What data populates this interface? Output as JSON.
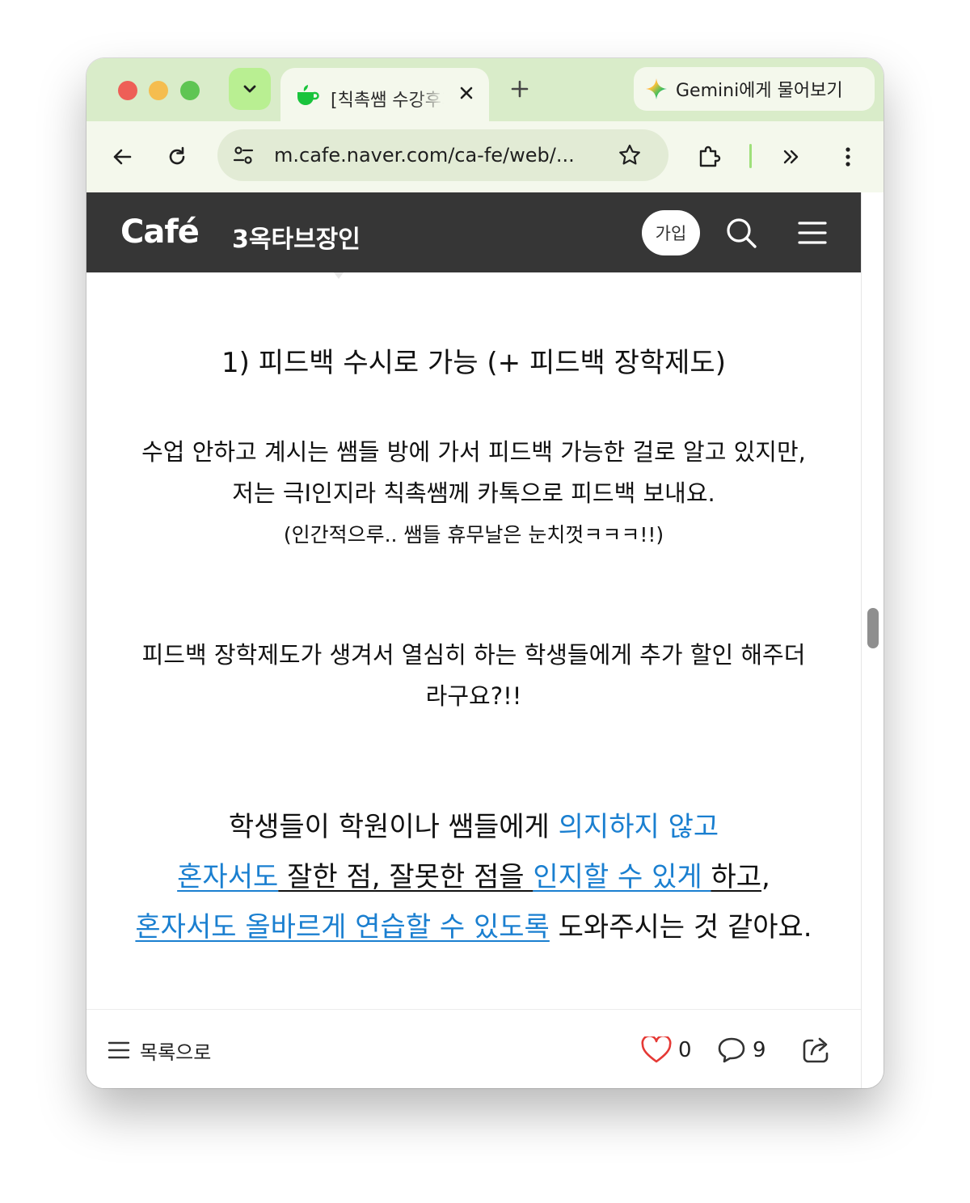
{
  "browser": {
    "tab_title": "[칙촉쌤 수강후기]",
    "gemini_label": "Gemini에게 물어보기",
    "url": "m.cafe.naver.com/ca-fe/web/..."
  },
  "cafe": {
    "logo": "Café",
    "name": "3옥타브장인",
    "join_label": "가입"
  },
  "article": {
    "heading": "1) 피드백 수시로 가능 (+ 피드백 장학제도)",
    "p1_line1": "수업 안하고 계시는 쌤들 방에 가서 피드백 가능한 걸로 알고 있지만,",
    "p1_line2": "저는 극I인지라 칙촉쌤께 카톡으로 피드백 보내요.",
    "p1_line3": "(인간적으루.. 쌤들 휴무날은 눈치껏ㅋㅋㅋ!!)",
    "p2_line1": "피드백 장학제도가 생겨서 열심히 하는 학생들에게 추가 할인 해주더",
    "p2_line2": "라구요?!!",
    "b_l1_a": "학생들이 학원이나 쌤들에게 ",
    "b_l1_b": "의지하지 않고",
    "b_l2_a": "혼자서도",
    "b_l2_b": " 잘한 점, 잘못한 점을 ",
    "b_l2_c": "인지할 수 있게 ",
    "b_l2_d": "하고",
    "b_l2_e": ",",
    "b_l3_a": "혼자서도 올바르게 연습할 수 있도록",
    "b_l3_b": " 도와주시는 것 같아요."
  },
  "footer": {
    "list_label": "목록으로",
    "like_count": "0",
    "comment_count": "9"
  },
  "colors": {
    "link_blue": "#1a7fd0",
    "header_bg": "#363636",
    "tabstrip_bg": "#d9ecc9",
    "like_red": "#e53935"
  }
}
